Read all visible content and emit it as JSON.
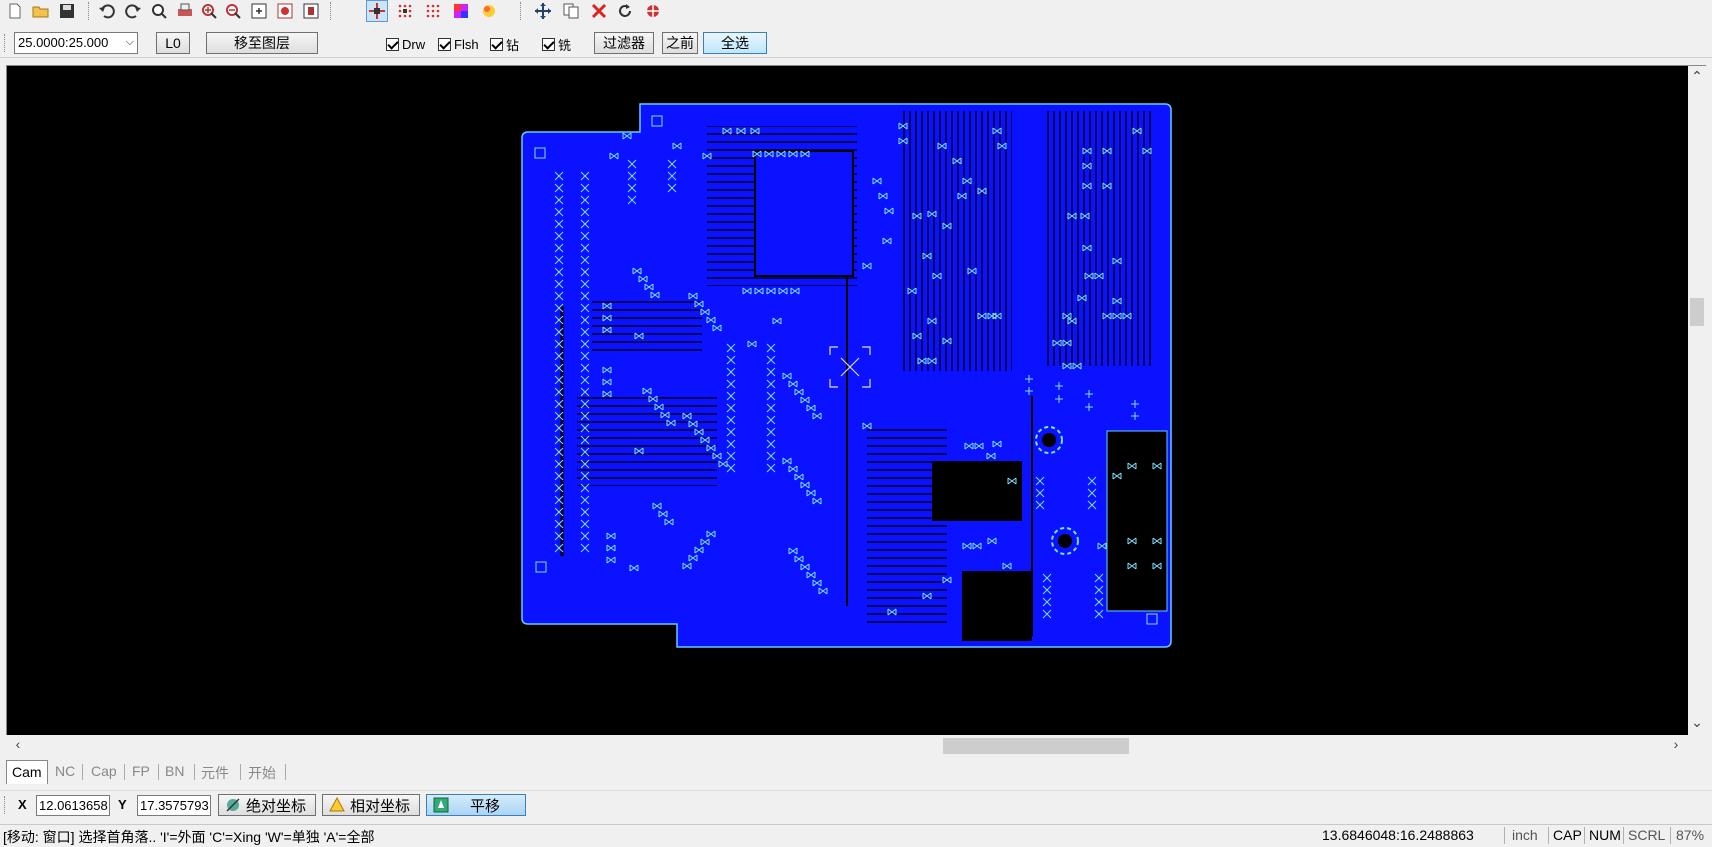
{
  "toolbar2": {
    "scale_value": "25.0000:25.000",
    "layer_button": "L0",
    "move_to_layer_button": "移至图层",
    "checkboxes": [
      {
        "label": "Drw",
        "checked": true
      },
      {
        "label": "Flsh",
        "checked": true
      },
      {
        "label": "钻",
        "checked": true
      },
      {
        "label": "铣",
        "checked": true
      }
    ],
    "filter_button": "过滤器",
    "previous_button": "之前",
    "select_all_button": "全选"
  },
  "toolbar1": {
    "icons": [
      "new-file-icon",
      "open-folder-icon",
      "save-icon",
      "undo-icon",
      "redo-icon",
      "zoom-window-icon",
      "print-icon",
      "zoom-in-icon",
      "zoom-out-icon",
      "zoom-fit-icon",
      "zoom-prev-icon",
      "zoom-next-icon",
      "snap-icon",
      "grid-icon",
      "grid-dots-icon",
      "color-icon",
      "layers-icon",
      "move-icon",
      "copy-icon",
      "delete-icon",
      "rotate-icon",
      "mirror-icon"
    ]
  },
  "canvas": {
    "background": "#000000",
    "board_color": "#0a12ff",
    "outline_color": "#66ccff",
    "pad_color": "#7fe0ff"
  },
  "tabs": [
    {
      "label": "Cam",
      "active": true
    },
    {
      "label": "NC",
      "active": false
    },
    {
      "label": "Cap",
      "active": false
    },
    {
      "label": "FP",
      "active": false
    },
    {
      "label": "BN",
      "active": false
    },
    {
      "label": "元件",
      "active": false
    },
    {
      "label": "开始",
      "active": false
    }
  ],
  "coordbar": {
    "x_label": "X",
    "x_value": "12.0613658",
    "y_label": "Y",
    "y_value": "17.3575793",
    "absolute_button": "绝对坐标",
    "relative_button": "相对坐标",
    "pan_button": "平移"
  },
  "statusbar": {
    "message": "[移动: 窗口] 选择首角落.. 'I'=外面 'C'=Xing 'W'=单独 'A'=全部",
    "coords": "13.6846048:16.2488863",
    "unit": "inch",
    "cap": "CAP",
    "num": "NUM",
    "scrl": "SCRL",
    "zoom": "87%"
  }
}
